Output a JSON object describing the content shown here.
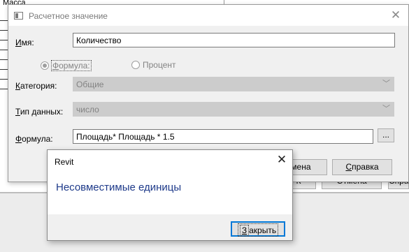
{
  "background": {
    "top_label": "Масса",
    "buttons": [
      "К",
      "Отмена",
      "Справ"
    ]
  },
  "dialog": {
    "title": "Расчетное значение",
    "name_label": "Имя:",
    "name_value": "Количество",
    "radio_formula": "Формула:",
    "radio_percent": "Процент",
    "category_label": "Категория:",
    "category_value": "Общие",
    "datatype_label": "Тип данных:",
    "datatype_value": "число",
    "formula_label": "Формула:",
    "formula_value": "Площадь* Площадь * 1.5",
    "ellipsis": "...",
    "cancel_label": "Отмена",
    "help_label": "Справка",
    "icons": {
      "title": "table-icon",
      "close": "close-icon",
      "dropdown": "chevron-down-icon"
    }
  },
  "alert": {
    "title": "Revit",
    "message": "Несовместимые единицы",
    "close_button": "Закрыть",
    "message_color": "#1e3a8a",
    "focus_color": "#0078d7"
  }
}
